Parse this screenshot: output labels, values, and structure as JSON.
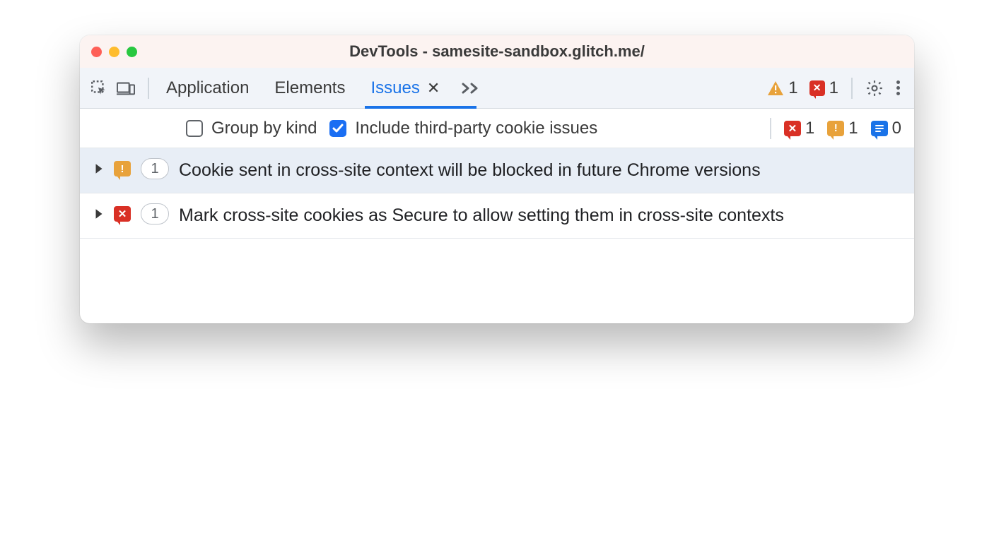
{
  "window": {
    "title": "DevTools - samesite-sandbox.glitch.me/"
  },
  "tabs": {
    "items": [
      "Application",
      "Elements",
      "Issues"
    ],
    "active_index": 2
  },
  "header_counts": {
    "warnings": "1",
    "errors": "1"
  },
  "filterbar": {
    "group_by_kind_label": "Group by kind",
    "group_by_kind_checked": false,
    "include_third_party_label": "Include third-party cookie issues",
    "include_third_party_checked": true,
    "counts": {
      "errors": "1",
      "warnings": "1",
      "info": "0"
    }
  },
  "issues": [
    {
      "severity": "warning",
      "count": "1",
      "title": "Cookie sent in cross-site context will be blocked in future Chrome versions",
      "selected": true
    },
    {
      "severity": "error",
      "count": "1",
      "title": "Mark cross-site cookies as Secure to allow setting them in cross-site contexts",
      "selected": false
    }
  ]
}
